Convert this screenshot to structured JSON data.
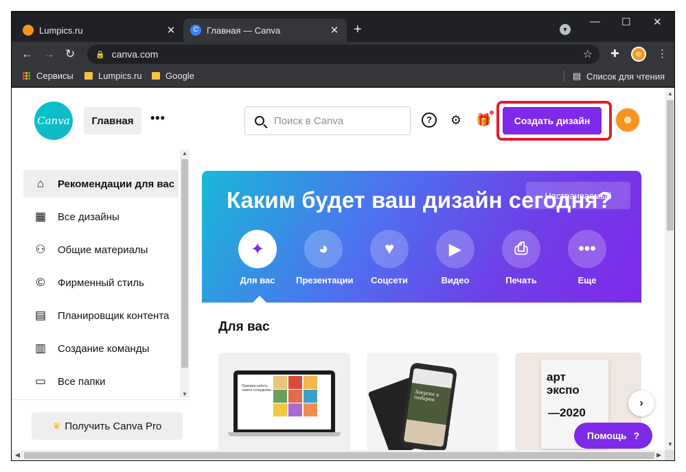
{
  "browser": {
    "tabs": [
      {
        "title": "Lumpics.ru",
        "favicon_color": "#f7941d",
        "active": false,
        "close": "✕"
      },
      {
        "title": "Главная — Canva",
        "favicon_color": "#3b82f6",
        "favicon_letter": "C",
        "active": true,
        "close": "✕"
      }
    ],
    "new_tab": "+",
    "window_controls": {
      "minimize": "—",
      "maximize": "☐",
      "close": "✕"
    },
    "url": "canva.com",
    "nav": {
      "back": "←",
      "forward": "→",
      "reload": "↻"
    },
    "bookmarks": [
      {
        "label": "Сервисы",
        "icon": "apps-icon"
      },
      {
        "label": "Lumpics.ru",
        "icon": "folder-icon"
      },
      {
        "label": "Google",
        "icon": "folder-icon"
      }
    ],
    "reading_list": "Список для чтения"
  },
  "canva": {
    "logo": "Canva",
    "home": "Главная",
    "more": "•••",
    "search": {
      "placeholder": "Поиск в Canva"
    },
    "create_button": "Создать дизайн",
    "accent_color": "#7d2ae8",
    "highlight_color": "#e11d2f"
  },
  "sidebar": {
    "items": [
      {
        "label": "Рекомендации для вас",
        "icon": "home-icon",
        "active": true
      },
      {
        "label": "Все дизайны",
        "icon": "grid-icon"
      },
      {
        "label": "Общие материалы",
        "icon": "people-icon"
      },
      {
        "label": "Фирменный стиль",
        "icon": "brand-icon"
      },
      {
        "label": "Планировщик контента",
        "icon": "calendar-icon"
      },
      {
        "label": "Создание команды",
        "icon": "building-icon"
      },
      {
        "label": "Все папки",
        "icon": "folder-icon"
      }
    ],
    "pro_button": "Получить Canva Pro"
  },
  "hero": {
    "title": "Каким будет ваш дизайн сегодня?",
    "custom_size": "Настраиваемый",
    "categories": [
      {
        "label": "Для вас",
        "icon": "sparkle-icon",
        "active": true
      },
      {
        "label": "Презентации",
        "icon": "presentation-icon"
      },
      {
        "label": "Соцсети",
        "icon": "heart-icon"
      },
      {
        "label": "Видео",
        "icon": "video-icon"
      },
      {
        "label": "Печать",
        "icon": "printer-icon"
      },
      {
        "label": "Еще",
        "icon": "more-icon"
      }
    ]
  },
  "for_you": {
    "title": "Для вас",
    "cards": [
      {
        "kind": "laptop",
        "text": "Приемка работу нового сотрудника"
      },
      {
        "kind": "phone",
        "text": "Закуска и подарок"
      },
      {
        "kind": "poster",
        "line1": "арт",
        "line2": "экспо",
        "year": "—2020"
      }
    ],
    "next": "›"
  },
  "help_button": "Помощь",
  "help_q": "?"
}
